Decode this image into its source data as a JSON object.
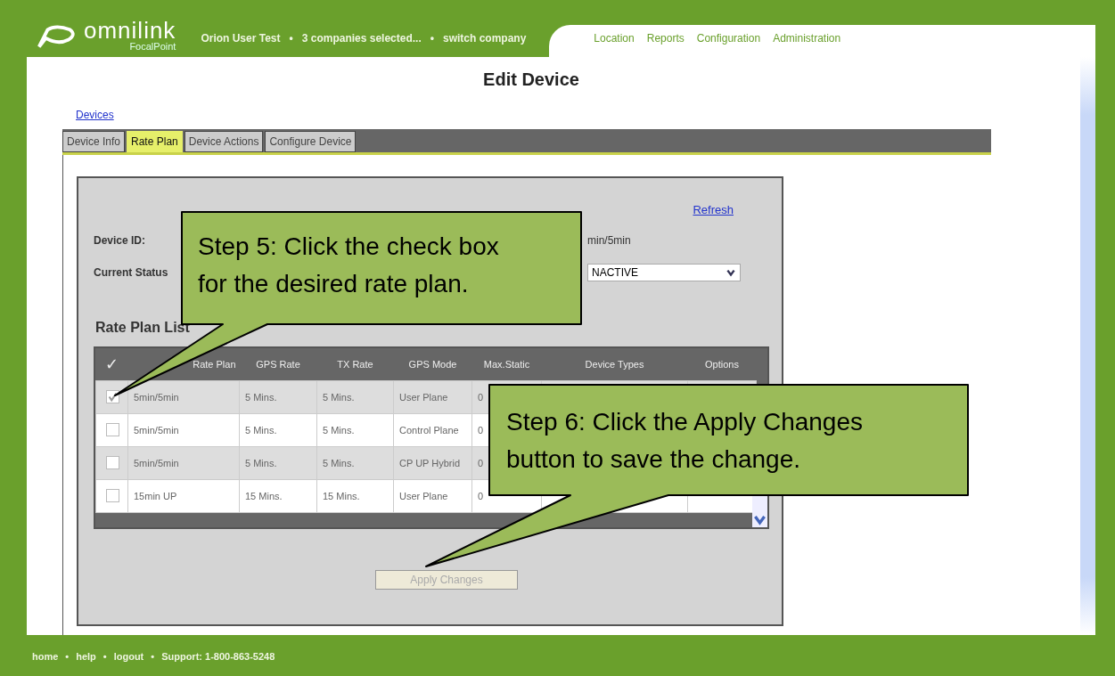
{
  "header": {
    "brand": "omnilink",
    "subbrand": "FocalPoint",
    "user": "Orion User Test",
    "companies": "3 companies selected...",
    "switch": "switch company",
    "separator": "•",
    "nav": [
      "Location",
      "Reports",
      "Configuration",
      "Administration"
    ]
  },
  "title": "Edit Device",
  "breadcrumb": "Devices",
  "tabs": [
    {
      "label": "Device Info",
      "selected": false
    },
    {
      "label": "Rate Plan",
      "selected": true
    },
    {
      "label": "Device Actions",
      "selected": false
    },
    {
      "label": "Configure Device",
      "selected": false
    }
  ],
  "refresh": "Refresh",
  "fields": [
    {
      "label": "Device ID:",
      "value": "min/5min",
      "kind": "text"
    },
    {
      "label": "Current Status",
      "value": "NACTIVE",
      "kind": "select"
    }
  ],
  "list_title": "Rate Plan List",
  "table": {
    "check_header": "✓",
    "columns": [
      "Rate Plan",
      "GPS Rate",
      "TX Rate",
      "GPS Mode",
      "Max.Static",
      "Device Types",
      "Options"
    ],
    "rows": [
      {
        "checked": true,
        "cells": [
          "5min/5min",
          "5 Mins.",
          "5 Mins.",
          "User Plane",
          "0"
        ]
      },
      {
        "checked": false,
        "cells": [
          "5min/5min",
          "5 Mins.",
          "5 Mins.",
          "Control Plane",
          "0"
        ]
      },
      {
        "checked": false,
        "cells": [
          "5min/5min",
          "5 Mins.",
          "5 Mins.",
          "CP UP Hybrid",
          "0"
        ]
      },
      {
        "checked": false,
        "cells": [
          "15min UP",
          "15 Mins.",
          "15 Mins.",
          "User Plane",
          "0"
        ]
      }
    ]
  },
  "apply_button": "Apply Changes",
  "callouts": [
    {
      "text": "Step 5: Click the check box for the desired rate plan."
    },
    {
      "text": "Step 6: Click the Apply Changes button to save the change."
    }
  ],
  "footer": {
    "separator": "•",
    "links": [
      "home",
      "help",
      "logout",
      "Support: 1-800-863-5248"
    ]
  }
}
